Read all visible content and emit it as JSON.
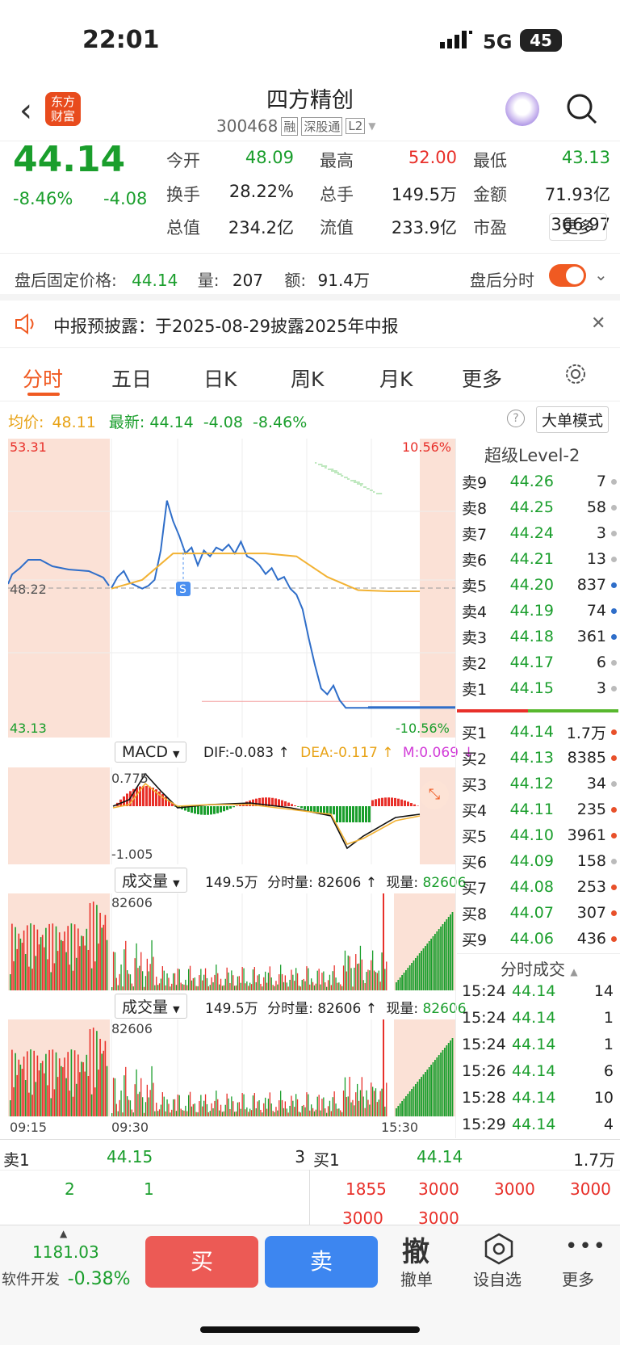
{
  "status": {
    "time": "22:01",
    "network": "5G",
    "battery": "45"
  },
  "header": {
    "title": "四方精创",
    "code": "300468",
    "tags": [
      "融",
      "深股通",
      "L2"
    ],
    "logo": "东方\n财富"
  },
  "quote": {
    "price": "44.14",
    "change_pct": "-8.46%",
    "change": "-4.08",
    "stats": [
      {
        "label": "今开",
        "value": "48.09",
        "color": "#1a9e2c"
      },
      {
        "label": "最高",
        "value": "52.00",
        "color": "#e8302a"
      },
      {
        "label": "最低",
        "value": "43.13",
        "color": "#1a9e2c"
      },
      {
        "label": "换手",
        "value": "28.22%",
        "color": "#222"
      },
      {
        "label": "总手",
        "value": "149.5万",
        "color": "#222"
      },
      {
        "label": "金额",
        "value": "71.93亿",
        "color": "#222"
      },
      {
        "label": "总值",
        "value": "234.2亿",
        "color": "#222"
      },
      {
        "label": "流值",
        "value": "233.9亿",
        "color": "#222"
      },
      {
        "label": "市盈",
        "value": "366.97",
        "color": "#222"
      }
    ],
    "more": "更多"
  },
  "afterhours": {
    "label": "盘后固定价格:",
    "price": "44.14",
    "vol_label": "量:",
    "vol": "207",
    "amt_label": "额:",
    "amt": "91.4万",
    "toggle_label": "盘后分时"
  },
  "notice": {
    "text": "中报预披露：于2025-08-29披露2025年中报"
  },
  "tabs": [
    "分时",
    "五日",
    "日K",
    "周K",
    "月K",
    "更多"
  ],
  "chart_header": {
    "avg_label": "均价:",
    "avg": "48.11",
    "latest_label": "最新:",
    "latest": "44.14",
    "change": "-4.08",
    "pct": "-8.46%",
    "mode_button": "大单模式"
  },
  "chart_data": {
    "type": "line",
    "title": "",
    "ylim": [
      43.13,
      53.31
    ],
    "ref_price": "48.22",
    "top_pct": "10.56%",
    "bottom_pct": "-10.56%",
    "top_price": "53.31",
    "bottom_price": "43.13",
    "x_ticks": [
      "09:15",
      "09:30",
      "15:30"
    ],
    "series": [
      {
        "name": "",
        "color": "#2f6ec9",
        "x": [
          0,
          2,
          4,
          6,
          8,
          10,
          12,
          14,
          16,
          18,
          20,
          22,
          24,
          26,
          28,
          30,
          32,
          34,
          36,
          38,
          40,
          42,
          44,
          46,
          48,
          50,
          52,
          54,
          56,
          58,
          60,
          62,
          64,
          66,
          68,
          70,
          72,
          74,
          76,
          78,
          80,
          82,
          84,
          86,
          88,
          90,
          92,
          94,
          96,
          98,
          100
        ],
        "values": [
          48.22,
          48.6,
          48.8,
          48.4,
          48.3,
          48.2,
          48.3,
          48.5,
          49.5,
          51.2,
          50.5,
          50.0,
          49.4,
          49.6,
          49.0,
          49.5,
          49.3,
          49.6,
          49.5,
          49.7,
          49.4,
          49.8,
          49.3,
          49.2,
          49.0,
          48.7,
          48.9,
          48.5,
          48.6,
          48.2,
          48.0,
          47.5,
          46.5,
          45.6,
          44.8,
          44.6,
          44.9,
          44.4,
          44.14,
          44.14,
          44.14,
          44.14,
          44.14,
          44.14,
          44.14,
          44.14,
          44.14,
          44.14,
          44.14,
          44.14,
          44.14
        ]
      },
      {
        "name": "",
        "color": "#f2b233",
        "x": [
          0,
          10,
          20,
          30,
          40,
          50,
          60,
          70,
          80,
          90,
          100
        ],
        "values": [
          48.2,
          48.5,
          49.4,
          49.4,
          49.4,
          49.4,
          49.3,
          48.6,
          48.15,
          48.11,
          48.11
        ]
      }
    ]
  },
  "macd": {
    "label": "MACD",
    "dif": "DIF:-0.083 ↑",
    "dea": "DEA:-0.117 ↑",
    "m": "M:0.069 ↓",
    "max": "0.775",
    "min": "-1.005"
  },
  "volume": {
    "label": "成交量",
    "total": "149.5万",
    "fenshi": "分时量: 82606 ↑",
    "xianliang": "现量:",
    "xianliang_val": "82606",
    "max": "82606"
  },
  "level2": {
    "title": "超级Level-2",
    "asks": [
      [
        "卖9",
        "44.26",
        "7",
        "#bbb"
      ],
      [
        "卖8",
        "44.25",
        "58",
        "#bbb"
      ],
      [
        "卖7",
        "44.24",
        "3",
        "#bbb"
      ],
      [
        "卖6",
        "44.21",
        "13",
        "#bbb"
      ],
      [
        "卖5",
        "44.20",
        "837",
        "#2f6ec9"
      ],
      [
        "卖4",
        "44.19",
        "74",
        "#2f6ec9"
      ],
      [
        "卖3",
        "44.18",
        "361",
        "#2f6ec9"
      ],
      [
        "卖2",
        "44.17",
        "6",
        "#bbb"
      ],
      [
        "卖1",
        "44.15",
        "3",
        "#bbb"
      ]
    ],
    "bids": [
      [
        "买1",
        "44.14",
        "1.7万",
        "#e8502a"
      ],
      [
        "买2",
        "44.13",
        "8385",
        "#e8502a"
      ],
      [
        "买3",
        "44.12",
        "34",
        "#bbb"
      ],
      [
        "买4",
        "44.11",
        "235",
        "#e8502a"
      ],
      [
        "买5",
        "44.10",
        "3961",
        "#e8502a"
      ],
      [
        "买6",
        "44.09",
        "158",
        "#bbb"
      ],
      [
        "买7",
        "44.08",
        "253",
        "#e8502a"
      ],
      [
        "买8",
        "44.07",
        "307",
        "#e8502a"
      ],
      [
        "买9",
        "44.06",
        "436",
        "#e8502a"
      ]
    ],
    "ticks_title": "分时成交",
    "ticks": [
      [
        "15:24",
        "44.14",
        "14"
      ],
      [
        "15:24",
        "44.14",
        "1"
      ],
      [
        "15:24",
        "44.14",
        "1"
      ],
      [
        "15:26",
        "44.14",
        "6"
      ],
      [
        "15:28",
        "44.14",
        "10"
      ],
      [
        "15:29",
        "44.14",
        "4"
      ]
    ]
  },
  "queue": {
    "sell_label": "卖1",
    "sell_price": "44.15",
    "sell_vol": "3",
    "sell_orders": [
      "2",
      "1"
    ],
    "buy_label": "买1",
    "buy_price": "44.14",
    "buy_vol": "1.7万",
    "buy_orders": [
      "1855",
      "3000",
      "3000",
      "3000",
      "3000",
      "3000"
    ]
  },
  "bottom": {
    "index_value": "1181.03",
    "index_name": "软件开发",
    "index_pct": "-0.38%",
    "buy": "买",
    "sell": "卖",
    "cancel_icon": "撤",
    "cancel": "撤单",
    "watch": "设自选",
    "more": "更多"
  }
}
